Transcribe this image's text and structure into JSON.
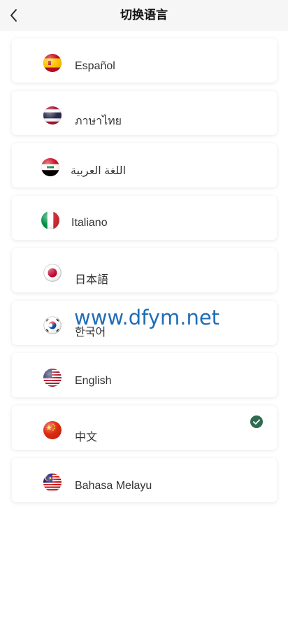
{
  "header": {
    "title": "切换语言"
  },
  "languages": [
    {
      "label": "Español"
    },
    {
      "label": "ภาษาไทย"
    },
    {
      "label": "اللغة العربية"
    },
    {
      "label": "Italiano"
    },
    {
      "label": "日本語"
    },
    {
      "label": "한국어"
    },
    {
      "label": "English"
    },
    {
      "label": "中文",
      "selected": true
    },
    {
      "label": "Bahasa Melayu"
    }
  ],
  "watermark": "www.dfym.net",
  "colors": {
    "accent": "#2e6b4f",
    "watermark": "#1f6db5"
  },
  "icons": {
    "back": "back-arrow-icon",
    "selected": "check-circle-icon"
  }
}
